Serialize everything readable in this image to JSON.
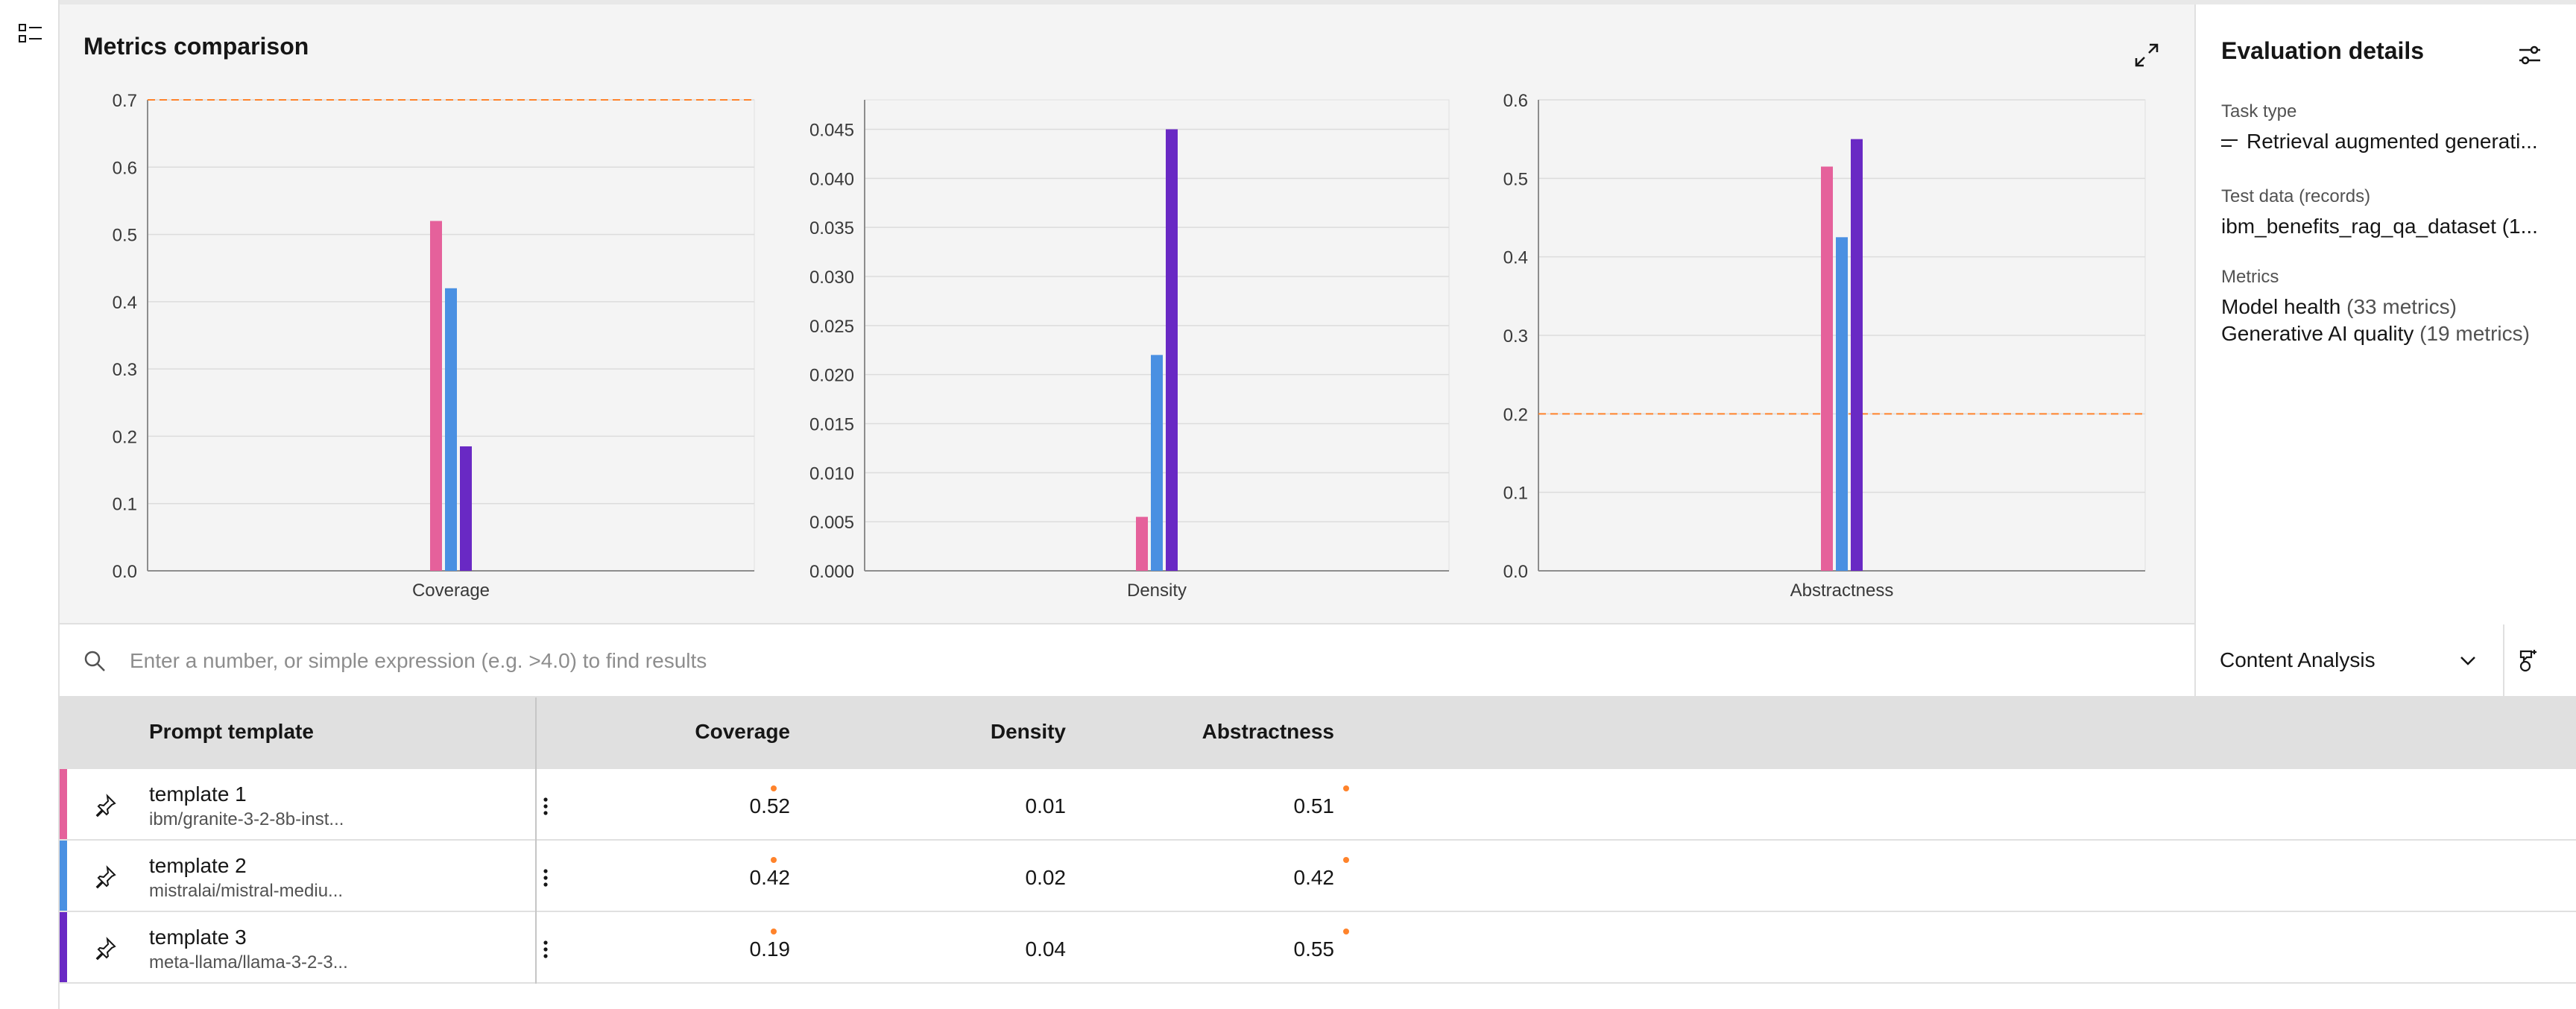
{
  "metrics_panel": {
    "title": "Metrics comparison"
  },
  "details": {
    "title": "Evaluation details",
    "task_type_label": "Task type",
    "task_type_value": "Retrieval augmented generati...",
    "test_data_label": "Test data (records)",
    "test_data_value": "ibm_benefits_rag_qa_dataset (1...",
    "metrics_label": "Metrics",
    "metric_1_name": "Model health",
    "metric_1_count": "(33 metrics)",
    "metric_2_name": "Generative AI quality",
    "metric_2_count": "(19 metrics)"
  },
  "search": {
    "placeholder": "Enter a number, or simple expression (e.g. >4.0) to find results"
  },
  "view_dropdown": {
    "selected": "Content Analysis"
  },
  "table": {
    "headers": {
      "template": "Prompt template",
      "coverage": "Coverage",
      "density": "Density",
      "abstractness": "Abstractness"
    },
    "rows": [
      {
        "name": "template 1",
        "model": "ibm/granite-3-2-8b-inst...",
        "coverage": "0.52",
        "density": "0.01",
        "abstractness": "0.51",
        "color": "#e5619b"
      },
      {
        "name": "template 2",
        "model": "mistralai/mistral-mediu...",
        "coverage": "0.42",
        "density": "0.02",
        "abstractness": "0.42",
        "color": "#4a90e2"
      },
      {
        "name": "template 3",
        "model": "meta-llama/llama-3-2-3...",
        "coverage": "0.19",
        "density": "0.04",
        "abstractness": "0.55",
        "color": "#6929c4"
      }
    ]
  },
  "colors": {
    "accent": "#ff832b",
    "series": [
      "#e5619b",
      "#4a90e2",
      "#6929c4"
    ]
  },
  "chart_data": [
    {
      "type": "bar",
      "categories": [
        "Coverage"
      ],
      "series": [
        {
          "values": [
            0.52
          ]
        },
        {
          "values": [
            0.42
          ]
        },
        {
          "values": [
            0.185
          ]
        }
      ],
      "ylim": [
        0,
        0.7
      ],
      "yticks": [
        "0.0",
        "0.1",
        "0.2",
        "0.3",
        "0.4",
        "0.5",
        "0.6",
        "0.7"
      ],
      "ytick_values": [
        0,
        0.1,
        0.2,
        0.3,
        0.4,
        0.5,
        0.6,
        0.7
      ],
      "threshold": 0.7,
      "grid": true
    },
    {
      "type": "bar",
      "categories": [
        "Density"
      ],
      "series": [
        {
          "values": [
            0.0055
          ]
        },
        {
          "values": [
            0.022
          ]
        },
        {
          "values": [
            0.045
          ]
        }
      ],
      "ylim": [
        0,
        0.048
      ],
      "yticks": [
        "0.000",
        "0.005",
        "0.010",
        "0.015",
        "0.020",
        "0.025",
        "0.030",
        "0.035",
        "0.040",
        "0.045"
      ],
      "ytick_values": [
        0,
        0.005,
        0.01,
        0.015,
        0.02,
        0.025,
        0.03,
        0.035,
        0.04,
        0.045
      ],
      "grid": true
    },
    {
      "type": "bar",
      "categories": [
        "Abstractness"
      ],
      "series": [
        {
          "values": [
            0.515
          ]
        },
        {
          "values": [
            0.425
          ]
        },
        {
          "values": [
            0.55
          ]
        }
      ],
      "ylim": [
        0,
        0.6
      ],
      "yticks": [
        "0.0",
        "0.1",
        "0.2",
        "0.3",
        "0.4",
        "0.5",
        "0.6"
      ],
      "ytick_values": [
        0,
        0.1,
        0.2,
        0.3,
        0.4,
        0.5,
        0.6
      ],
      "threshold": 0.2,
      "grid": true
    }
  ]
}
